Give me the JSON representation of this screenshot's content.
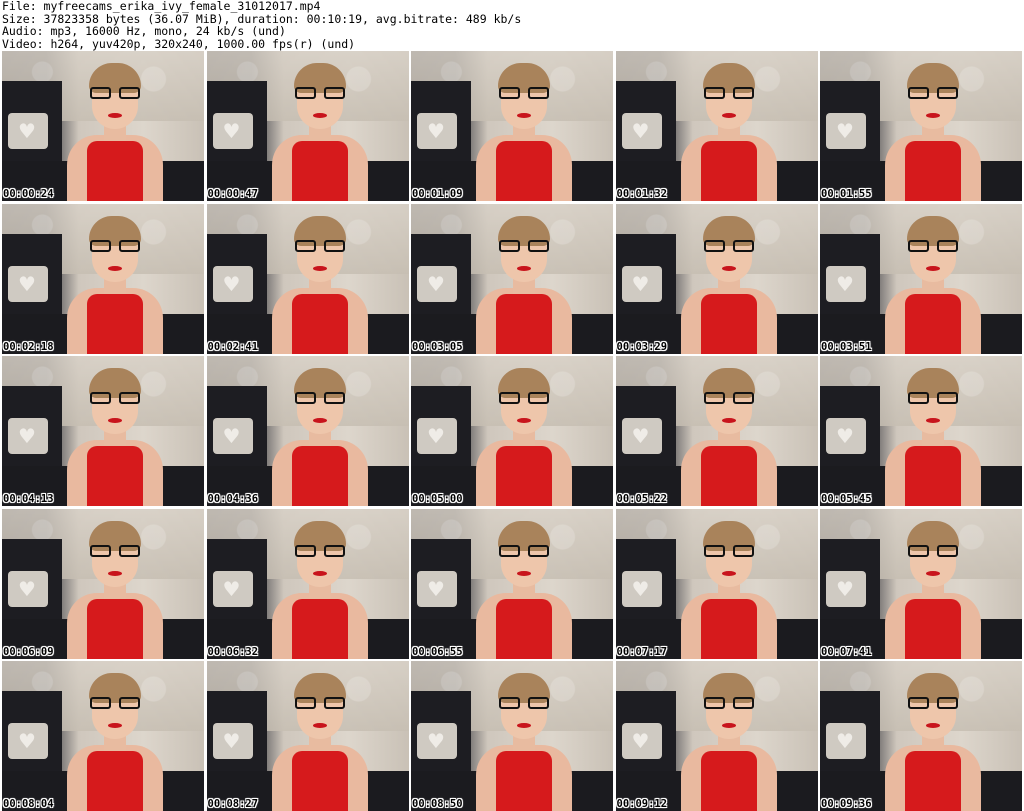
{
  "header": {
    "file": "File: myfreecams_erika_ivy_female_31012017.mp4",
    "size": "Size: 37823358 bytes (36.07 MiB), duration: 00:10:19, avg.bitrate: 489 kb/s",
    "audio": "Audio: mp3, 16000 Hz, mono, 24 kb/s (und)",
    "video": "Video: h264, yuv420p, 320x240, 1000.00 fps(r) (und)"
  },
  "thumbnails": [
    {
      "timestamp": "00:00:24"
    },
    {
      "timestamp": "00:00:47"
    },
    {
      "timestamp": "00:01:09"
    },
    {
      "timestamp": "00:01:32"
    },
    {
      "timestamp": "00:01:55"
    },
    {
      "timestamp": "00:02:18"
    },
    {
      "timestamp": "00:02:41"
    },
    {
      "timestamp": "00:03:05"
    },
    {
      "timestamp": "00:03:29"
    },
    {
      "timestamp": "00:03:51"
    },
    {
      "timestamp": "00:04:13"
    },
    {
      "timestamp": "00:04:36"
    },
    {
      "timestamp": "00:05:00"
    },
    {
      "timestamp": "00:05:22"
    },
    {
      "timestamp": "00:05:45"
    },
    {
      "timestamp": "00:06:09"
    },
    {
      "timestamp": "00:06:32"
    },
    {
      "timestamp": "00:06:55"
    },
    {
      "timestamp": "00:07:17"
    },
    {
      "timestamp": "00:07:41"
    },
    {
      "timestamp": "00:08:04"
    },
    {
      "timestamp": "00:08:27"
    },
    {
      "timestamp": "00:08:50"
    },
    {
      "timestamp": "00:09:12"
    },
    {
      "timestamp": "00:09:36"
    }
  ],
  "colors": {
    "background": "#ffffff",
    "top_red": "#d61a1c",
    "sofa": "#1b1b1f"
  }
}
